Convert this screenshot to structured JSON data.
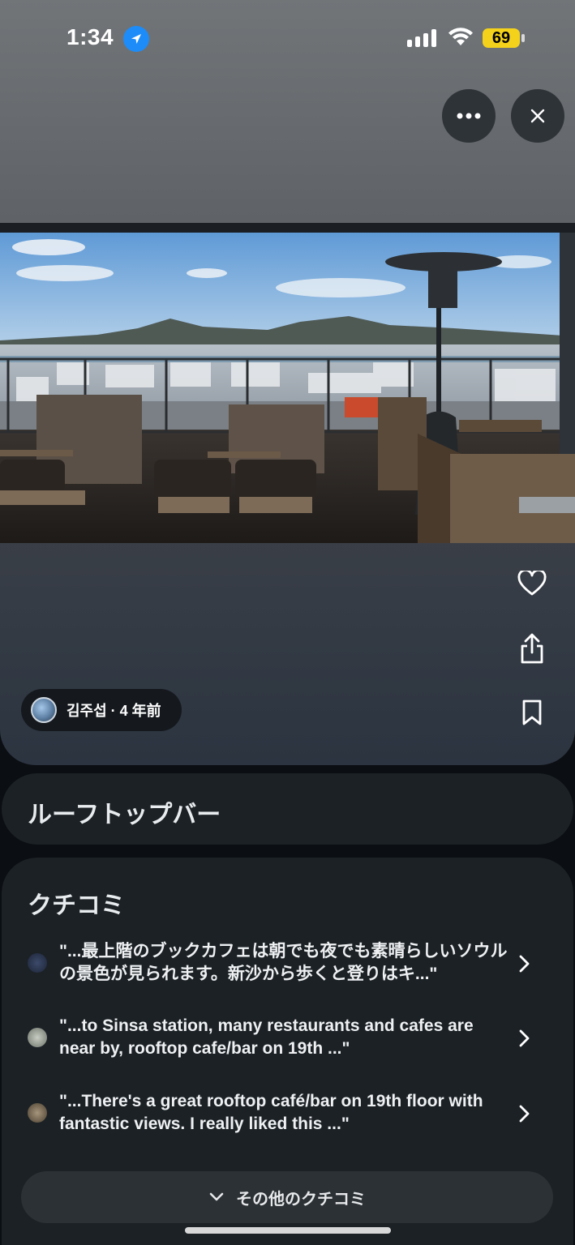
{
  "status_bar": {
    "time": "1:34",
    "battery": "69"
  },
  "toolbar": {
    "more_icon": "ellipsis-icon",
    "close_icon": "close-icon"
  },
  "photo": {
    "description_icon": "photo"
  },
  "side_actions": [
    "heart-icon",
    "share-icon",
    "bookmark-icon"
  ],
  "author": {
    "name_time": "김주섭 · 4 年前"
  },
  "place": {
    "title": "ルーフトップバー"
  },
  "reviews": {
    "heading": "クチコミ",
    "items": [
      {
        "pre": "\"...最上階のブックカフェは朝でも夜でも素晴らしいソウルの景色が見られます。新沙から歩くと登りはキ...\"",
        "bold": "",
        "post": ""
      },
      {
        "pre": "\"...to Sinsa station, many restaurants and cafes are near by, ",
        "bold": "rooftop cafe",
        "post": "/bar on 19th ...\""
      },
      {
        "pre": "\"...There's a great ",
        "bold": "rooftop café",
        "post": "/bar on 19th floor with fantastic views. I really liked this ...\""
      }
    ],
    "more_label": "その他のクチコミ"
  },
  "colors": {
    "accent_blue": "#1d8cf8",
    "battery_yellow": "#f4d21b",
    "card_bg": "#1b2125"
  }
}
